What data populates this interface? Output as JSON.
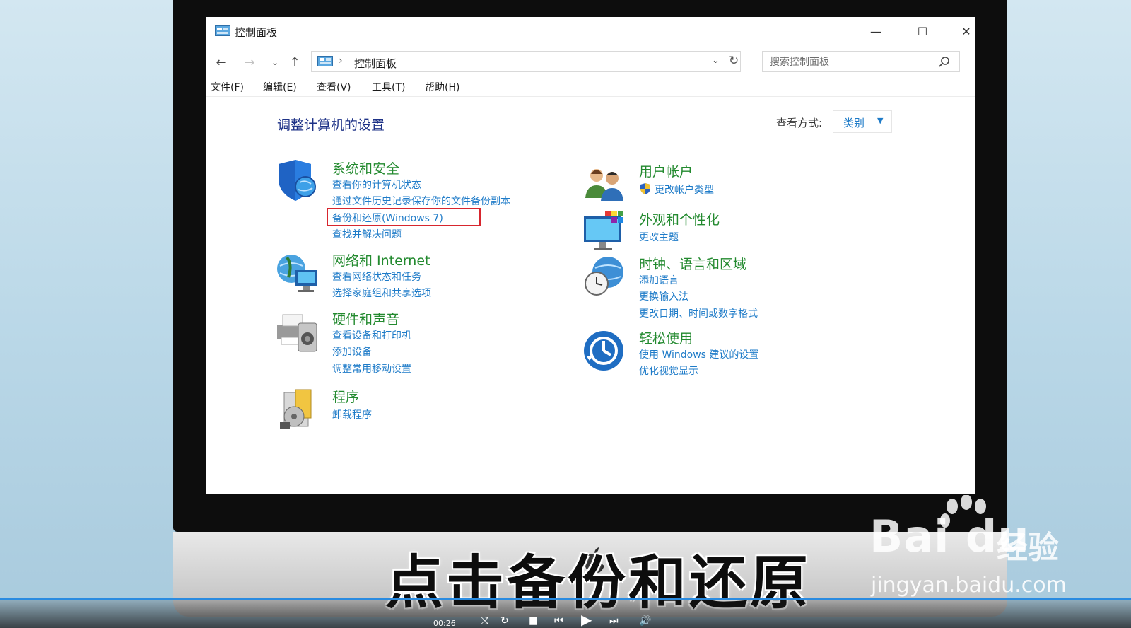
{
  "window": {
    "title": "控制面板",
    "minimize": "—",
    "maximize": "☐",
    "close": "✕"
  },
  "nav": {
    "back": "←",
    "forward": "→",
    "recent": "⌄",
    "up": "↑",
    "address_sep": "›",
    "address": "控制面板",
    "address_dropdown": "⌄",
    "refresh": "↻",
    "search_placeholder": "搜索控制面板"
  },
  "menu": [
    "文件(F)",
    "编辑(E)",
    "查看(V)",
    "工具(T)",
    "帮助(H)"
  ],
  "main": {
    "heading": "调整计算机的设置",
    "view_by_label": "查看方式:",
    "view_by_value": "类别",
    "view_by_caret": "▼"
  },
  "categories_left": [
    {
      "title": "系统和安全",
      "links": [
        "查看你的计算机状态",
        "通过文件历史记录保存你的文件备份副本",
        "备份和还原(Windows 7)",
        "查找并解决问题"
      ]
    },
    {
      "title": "网络和 Internet",
      "links": [
        "查看网络状态和任务",
        "选择家庭组和共享选项"
      ]
    },
    {
      "title": "硬件和声音",
      "links": [
        "查看设备和打印机",
        "添加设备",
        "调整常用移动设置"
      ]
    },
    {
      "title": "程序",
      "links": [
        "卸载程序"
      ]
    }
  ],
  "categories_right": [
    {
      "title": "用户帐户",
      "links": [
        "更改帐户类型"
      ]
    },
    {
      "title": "外观和个性化",
      "links": [
        "更改主题"
      ]
    },
    {
      "title": "时钟、语言和区域",
      "links": [
        "添加语言",
        "更换输入法",
        "更改日期、时间或数字格式"
      ]
    },
    {
      "title": "轻松使用",
      "links": [
        "使用 Windows 建议的设置",
        "优化视觉显示"
      ]
    }
  ],
  "overlay": {
    "caption": "点击备份和还原",
    "watermark_baidu": "Bai du",
    "watermark_jingyan": "经验",
    "watermark_url": "jingyan.baidu.com",
    "player_time": "00:26"
  },
  "colors": {
    "link_blue": "#1e7bc8",
    "category_green": "#238a2f",
    "heading_navy": "#1e3287",
    "highlight_red": "#d7262e"
  }
}
